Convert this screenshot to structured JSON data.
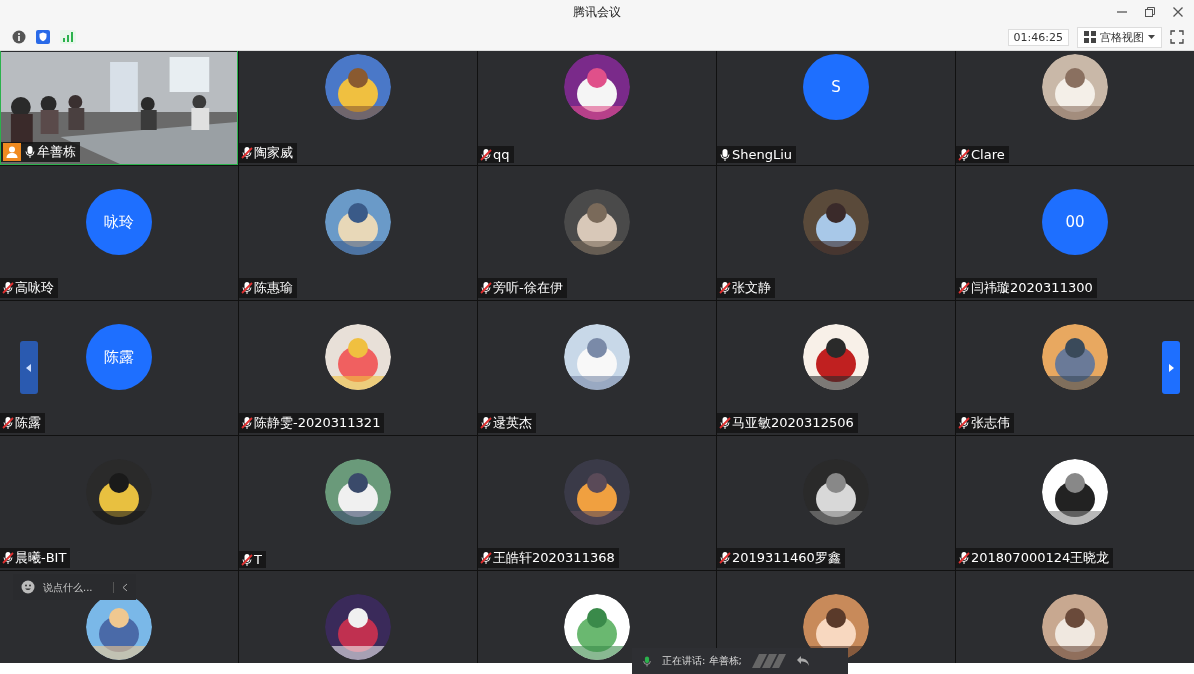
{
  "window": {
    "title": "腾讯会议"
  },
  "toolbar": {
    "timer": "01:46:25",
    "view_mode": "宫格视图"
  },
  "tiles": [
    {
      "kind": "video",
      "name": "牟善栋",
      "muted": false,
      "host": true
    },
    {
      "kind": "picture",
      "name": "陶家威",
      "muted": true
    },
    {
      "kind": "picture",
      "name": "qq",
      "muted": true
    },
    {
      "kind": "initials",
      "initials": "S",
      "name": "ShengLiu",
      "muted": false
    },
    {
      "kind": "picture",
      "name": "Clare",
      "muted": true
    },
    {
      "kind": "initials",
      "initials": "咏玲",
      "name": "高咏玲",
      "muted": true
    },
    {
      "kind": "picture",
      "name": "陈惠瑜",
      "muted": true
    },
    {
      "kind": "picture",
      "name": "旁听-徐在伊",
      "muted": true
    },
    {
      "kind": "picture",
      "name": "张文静",
      "muted": true
    },
    {
      "kind": "initials",
      "initials": "00",
      "name": "闫祎璇2020311300",
      "muted": true
    },
    {
      "kind": "initials",
      "initials": "陈露",
      "name": "陈露",
      "muted": true
    },
    {
      "kind": "picture",
      "name": "陈静雯-2020311321",
      "muted": true
    },
    {
      "kind": "picture",
      "name": "逯英杰",
      "muted": true
    },
    {
      "kind": "picture",
      "name": "马亚敏2020312506",
      "muted": true
    },
    {
      "kind": "picture",
      "name": "张志伟",
      "muted": true
    },
    {
      "kind": "picture",
      "name": "晨曦-BIT",
      "muted": true
    },
    {
      "kind": "picture",
      "name": "T",
      "muted": true
    },
    {
      "kind": "picture",
      "name": "王皓轩2020311368",
      "muted": true
    },
    {
      "kind": "picture",
      "name": "2019311460罗鑫",
      "muted": true
    },
    {
      "kind": "picture",
      "name": "201807000124王晓龙",
      "muted": true
    },
    {
      "kind": "picture"
    },
    {
      "kind": "picture"
    },
    {
      "kind": "picture"
    },
    {
      "kind": "picture"
    },
    {
      "kind": "picture"
    }
  ],
  "chat": {
    "placeholder": "说点什么..."
  },
  "speaking": {
    "text": "正在讲话: 牟善栋;"
  }
}
